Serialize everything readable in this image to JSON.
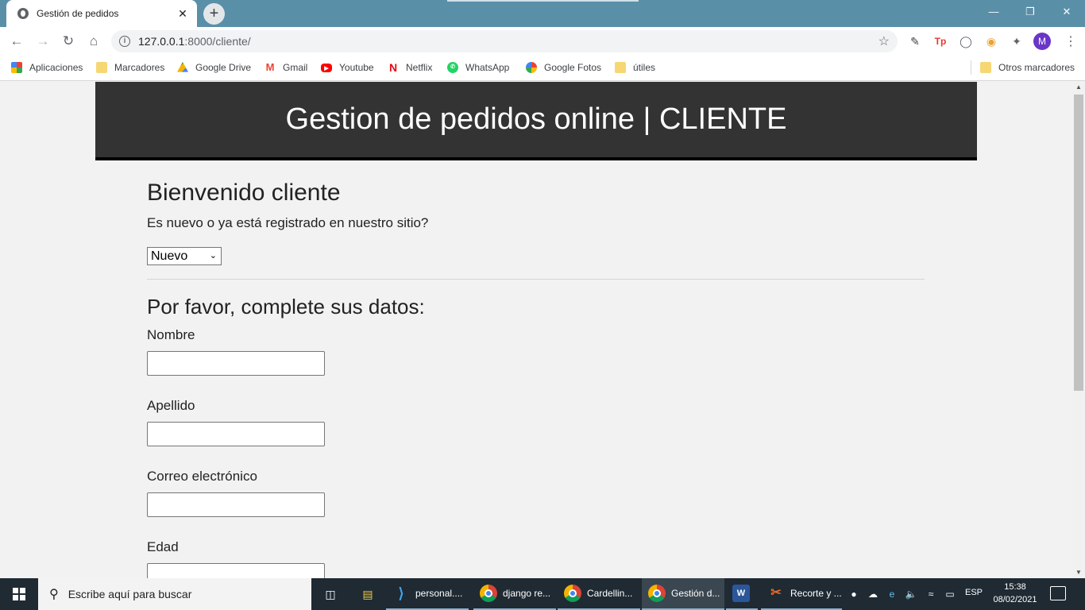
{
  "browser": {
    "tab_title": "Gestión de pedidos",
    "tab_close": "✕",
    "new_tab": "+",
    "url_host": "127.0.0.1",
    "url_path": ":8000/cliente/",
    "profile_initial": "M",
    "bookmarks": [
      {
        "label": "Aplicaciones",
        "icon": "apps-grid-icon"
      },
      {
        "label": "Marcadores",
        "icon": "folder-icon"
      },
      {
        "label": "Google Drive",
        "icon": "google-drive-icon"
      },
      {
        "label": "Gmail",
        "icon": "gmail-icon"
      },
      {
        "label": "Youtube",
        "icon": "youtube-icon"
      },
      {
        "label": "Netflix",
        "icon": "netflix-icon"
      },
      {
        "label": "WhatsApp",
        "icon": "whatsapp-icon"
      },
      {
        "label": "Google Fotos",
        "icon": "google-photos-icon"
      },
      {
        "label": "útiles",
        "icon": "folder-icon"
      }
    ],
    "other_bookmarks": "Otros marcadores"
  },
  "page": {
    "header_title": "Gestion de pedidos online | CLIENTE",
    "welcome": "Bienvenido cliente",
    "question": "Es nuevo o ya está registrado en nuestro sitio?",
    "client_type_selected": "Nuevo",
    "form_title": "Por favor, complete sus datos:",
    "fields": [
      {
        "label": "Nombre",
        "value": ""
      },
      {
        "label": "Apellido",
        "value": ""
      },
      {
        "label": "Correo electrónico",
        "value": ""
      },
      {
        "label": "Edad",
        "value": ""
      }
    ]
  },
  "taskbar": {
    "search_placeholder": "Escribe aquí para buscar",
    "apps": [
      {
        "label": "personal....",
        "icon": "vscode-icon"
      },
      {
        "label": "django re...",
        "icon": "chrome-icon"
      },
      {
        "label": "Cardellin...",
        "icon": "chrome-icon"
      },
      {
        "label": "Gestión d...",
        "icon": "chrome-icon"
      },
      {
        "label": "",
        "icon": "word-icon"
      },
      {
        "label": "Recorte y ...",
        "icon": "snip-sketch-icon"
      }
    ],
    "language": "ESP",
    "time": "15:38",
    "date": "08/02/2021"
  },
  "colors": {
    "tabbar": "#5a8fa8",
    "site_header": "#333333",
    "page_bg": "#f2f2f2",
    "taskbar": "#1f2a33"
  }
}
